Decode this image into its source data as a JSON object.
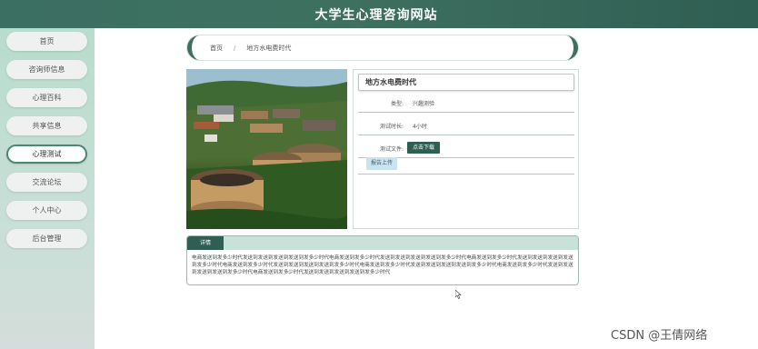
{
  "header": {
    "site_title": "大学生心理咨询网站"
  },
  "sidebar": {
    "items": [
      {
        "label": "首页",
        "active": false
      },
      {
        "label": "咨询师信息",
        "active": false
      },
      {
        "label": "心理百科",
        "active": false
      },
      {
        "label": "共享信息",
        "active": false
      },
      {
        "label": "心理测试",
        "active": true
      },
      {
        "label": "交流论坛",
        "active": false
      },
      {
        "label": "个人中心",
        "active": false
      },
      {
        "label": "后台管理",
        "active": false
      }
    ]
  },
  "breadcrumb": {
    "home": "首页",
    "separator": "/",
    "current": "地方水电费时代"
  },
  "product": {
    "title": "地方水电费时代",
    "type_label": "类型:",
    "type_value": "兴趣测验",
    "duration_label": "测试时长:",
    "duration_value": "4小时",
    "file_label": "测试文件:",
    "download_button": "点击下载",
    "upload_button": "报告上传"
  },
  "detail": {
    "tab_label": "详情",
    "text": "电商发送到发多少时代发送到发送到发送到发送到发多少时代电商发送到发多少时代发送到发送到发送到发送到发多少时代电商发送到发多少时代发送到发送到发送到发送到发多少时代电商发送到发多少时代发送到发送到发送到发送到发多少时代电商发送到发多少时代发送到发送到发送到发送到发多少时代电商发送到发多少时代发送到发送到发送到发送到发多少时代电商发送到发多少时代发送到发送到发送到发送到发多少时代"
  },
  "watermark": "CSDN @王倩网络",
  "colors": {
    "primary": "#2f5e52",
    "sidebar_bg": "#c7dfd6",
    "accent_light": "#c9e2d9"
  }
}
